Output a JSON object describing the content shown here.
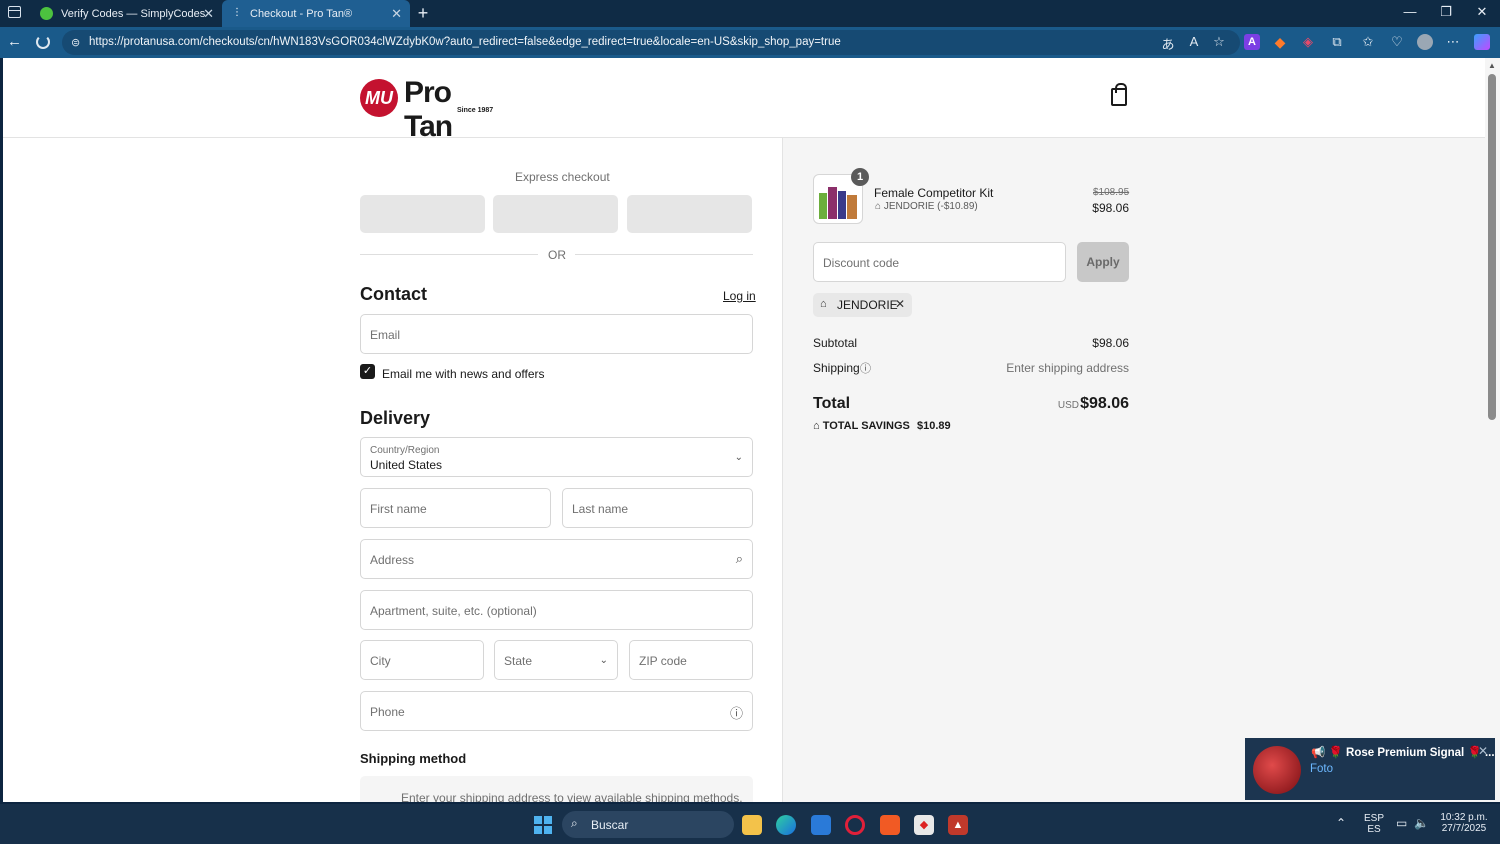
{
  "browser": {
    "tabs": [
      {
        "title": "Verify Codes — SimplyCodes",
        "active": false
      },
      {
        "title": "Checkout - Pro Tan®",
        "active": true
      }
    ],
    "url": "https://protanusa.com/checkouts/cn/hWN183VsGOR034clWZdybK0w?auto_redirect=false&edge_redirect=true&locale=en-US&skip_shop_pay=true",
    "new_tab_label": "+",
    "minimize_label": "—",
    "restore_label": "❐",
    "close_label": "✕"
  },
  "header": {
    "logo_badge": "MU",
    "logo_word": "Pro Tan",
    "logo_since": "Since 1987"
  },
  "checkout": {
    "express_label": "Express checkout",
    "or_label": "OR",
    "contact_title": "Contact",
    "login_label": "Log in",
    "email_placeholder": "Email",
    "newsletter_label": "Email me with news and offers",
    "newsletter_checked": true,
    "delivery_title": "Delivery",
    "country_label": "Country/Region",
    "country_value": "United States",
    "first_name_placeholder": "First name",
    "last_name_placeholder": "Last name",
    "address_placeholder": "Address",
    "apartment_placeholder": "Apartment, suite, etc. (optional)",
    "city_placeholder": "City",
    "state_placeholder": "State",
    "zip_placeholder": "ZIP code",
    "phone_placeholder": "Phone",
    "shipping_method_title": "Shipping method",
    "shipping_method_note": "Enter your shipping address to view available shipping methods."
  },
  "summary": {
    "product": {
      "name": "Female Competitor Kit",
      "quantity": "1",
      "discount_line": "JENDORIE (-$10.89)",
      "original_price": "$108.95",
      "price": "$98.06"
    },
    "discount_placeholder": "Discount code",
    "apply_label": "Apply",
    "applied_code": "JENDORIE",
    "subtotal_label": "Subtotal",
    "subtotal_value": "$98.06",
    "shipping_label": "Shipping",
    "shipping_value": "Enter shipping address",
    "total_label": "Total",
    "total_currency": "USD",
    "total_value": "$98.06",
    "savings_label": "TOTAL SAVINGS",
    "savings_value": "$10.89"
  },
  "taskbar": {
    "search_label": "Buscar",
    "lang_top": "ESP",
    "lang_bottom": "ES",
    "time": "10:32 p.m.",
    "date": "27/7/2025"
  },
  "notification": {
    "title": "📢 🌹 Rose Premium Signal 🌹 ...",
    "subtitle": "Foto"
  },
  "colors": {
    "accent": "#1a5a8a",
    "brand_red": "#c4122f",
    "link": "#1a1a1a"
  }
}
